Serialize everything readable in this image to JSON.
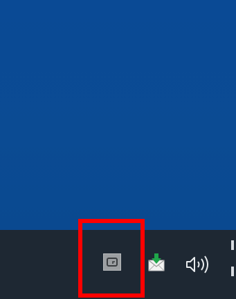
{
  "desktop": {
    "background_color": "#0b4a93"
  },
  "taskbar": {
    "background_color": "#1e2833",
    "tray": {
      "items": [
        {
          "icon": "app-tray-icon"
        },
        {
          "icon": "mail-download-icon"
        },
        {
          "icon": "speaker-volume-icon"
        }
      ]
    }
  },
  "highlight": {
    "color": "#ff0000"
  }
}
